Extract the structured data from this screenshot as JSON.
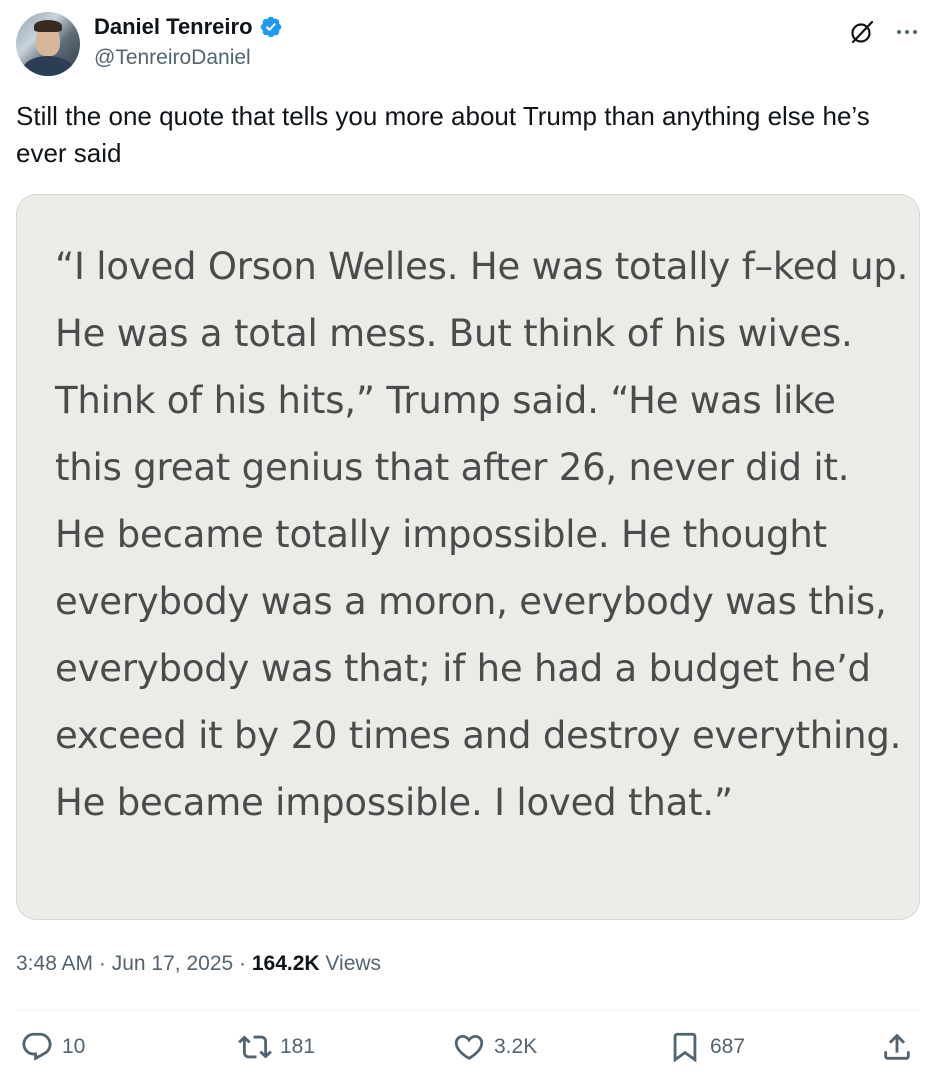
{
  "author": {
    "display_name": "Daniel Tenreiro",
    "handle": "@TenreiroDaniel",
    "verified": true
  },
  "tweet": {
    "text": "Still the one quote that tells you more about Trump than anything else he’s ever said",
    "quote_image_text": "“I loved Orson Welles. He was totally f–ked up. He was a total mess. But think of his wives. Think of his hits,” Trump said. “He was like this great genius that after 26, never did it. He became totally impossible. He thought everybody was a moron, everybody was this, everybody was that; if he had a budget he’d exceed it by 20 times and destroy everything. He became impossible. I loved that.”"
  },
  "meta": {
    "time": "3:48 AM",
    "separator1": " · ",
    "date": "Jun 17, 2025",
    "separator2": " · ",
    "views_count": "164.2K",
    "views_label": " Views"
  },
  "actions": {
    "replies": "10",
    "reposts": "181",
    "likes": "3.2K",
    "bookmarks": "687"
  },
  "icons": {
    "verified": "verified-badge-icon",
    "grok": "grok-icon",
    "more": "more-icon",
    "reply": "reply-icon",
    "repost": "repost-icon",
    "like": "heart-icon",
    "bookmark": "bookmark-icon",
    "share": "share-icon"
  },
  "colors": {
    "verified_blue": "#1d9bf0",
    "text_primary": "#0f1419",
    "text_secondary": "#536471",
    "quote_card_bg": "#ecebe7"
  }
}
